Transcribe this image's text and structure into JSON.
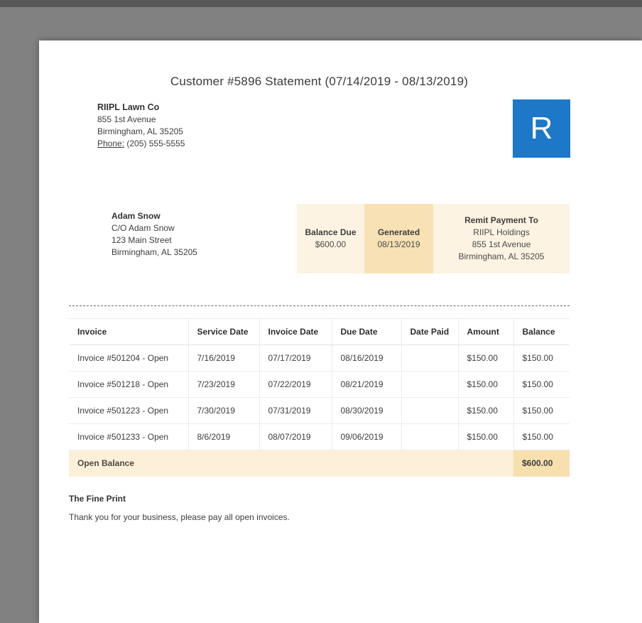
{
  "page": {
    "title": "Customer #5896 Statement (07/14/2019 - 08/13/2019)"
  },
  "company": {
    "name": "RIIPL Lawn Co",
    "address1": "855 1st Avenue",
    "address2": "Birmingham, AL 35205",
    "phone_label": "Phone:",
    "phone": "(205) 555-5555",
    "logo_letter": "R"
  },
  "customer": {
    "name": "Adam Snow",
    "care_of": "C/O Adam Snow",
    "address1": "123 Main Street",
    "address2": "Birmingham, AL 35205"
  },
  "summary": {
    "balance_due_label": "Balance Due",
    "balance_due_value": "$600.00",
    "generated_label": "Generated",
    "generated_value": "08/13/2019",
    "remit_label": "Remit Payment To",
    "remit_name": "RIIPL Holdings",
    "remit_address1": "855 1st Avenue",
    "remit_address2": "Birmingham, AL 35205"
  },
  "table": {
    "headers": [
      "Invoice",
      "Service Date",
      "Invoice Date",
      "Due Date",
      "Date Paid",
      "Amount",
      "Balance"
    ],
    "rows": [
      {
        "invoice": "Invoice #501204 - Open",
        "service_date": "7/16/2019",
        "invoice_date": "07/17/2019",
        "due_date": "08/16/2019",
        "date_paid": "",
        "amount": "$150.00",
        "balance": "$150.00"
      },
      {
        "invoice": "Invoice #501218 - Open",
        "service_date": "7/23/2019",
        "invoice_date": "07/22/2019",
        "due_date": "08/21/2019",
        "date_paid": "",
        "amount": "$150.00",
        "balance": "$150.00"
      },
      {
        "invoice": "Invoice #501223 - Open",
        "service_date": "7/30/2019",
        "invoice_date": "07/31/2019",
        "due_date": "08/30/2019",
        "date_paid": "",
        "amount": "$150.00",
        "balance": "$150.00"
      },
      {
        "invoice": "Invoice #501233 - Open",
        "service_date": "8/6/2019",
        "invoice_date": "08/07/2019",
        "due_date": "09/06/2019",
        "date_paid": "",
        "amount": "$150.00",
        "balance": "$150.00"
      }
    ],
    "footer": {
      "label": "Open Balance",
      "balance": "$600.00"
    }
  },
  "fine_print": {
    "heading": "The Fine Print",
    "text": "Thank you for your business, please pay all open invoices."
  },
  "colors": {
    "brand_blue": "#1d78c7",
    "summary_bg_light": "#fdf3e2",
    "summary_bg_dark": "#f8e2b5",
    "footer_bg": "#fdf0d8",
    "footer_total_bg": "#f8dfae"
  }
}
